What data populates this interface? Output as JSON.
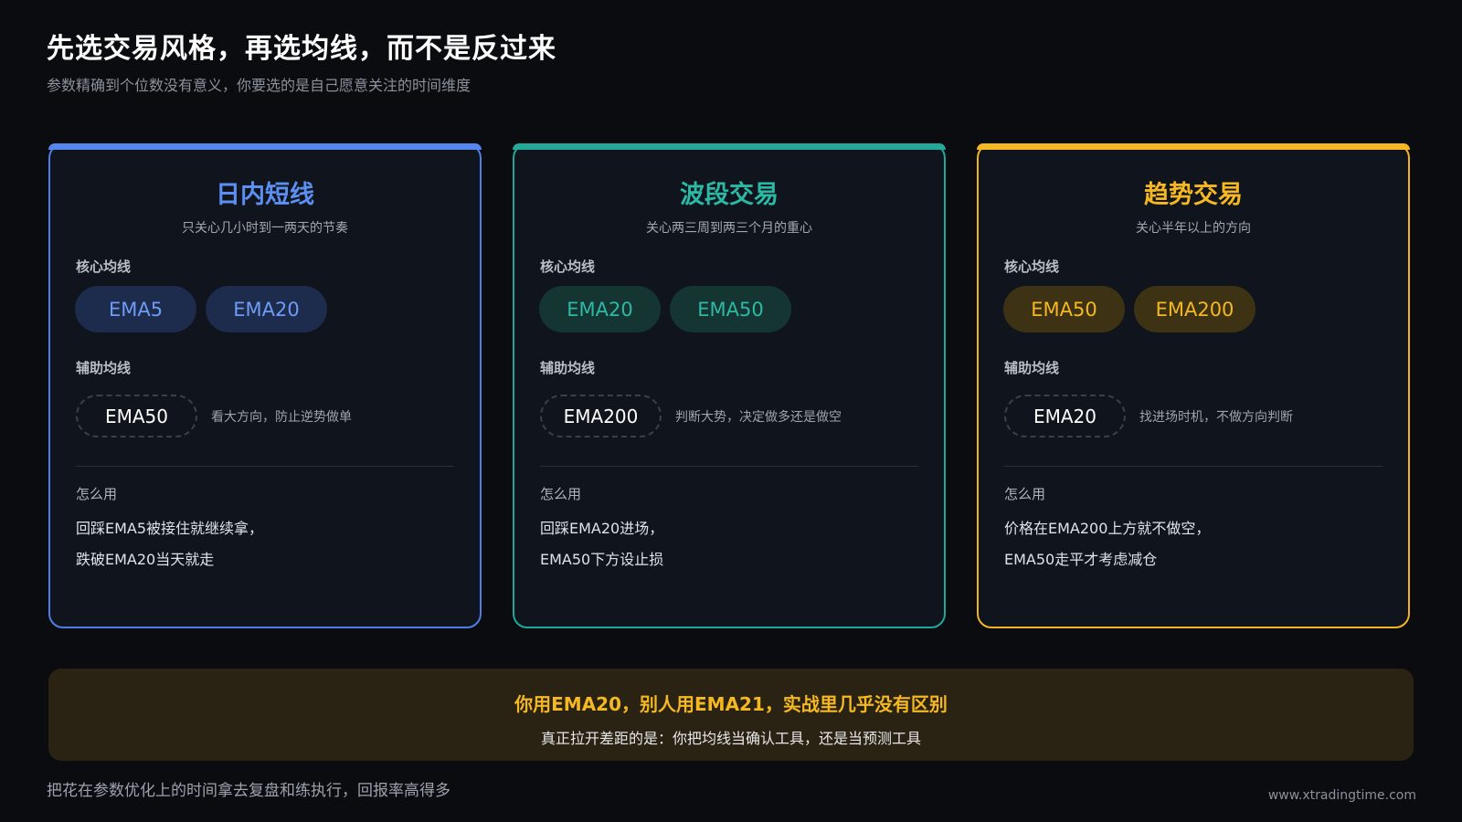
{
  "header": {
    "title": "先选交易风格，再选均线，而不是反过来",
    "subtitle": "参数精确到个位数没有意义，你要选的是自己愿意关注的时间维度"
  },
  "labels": {
    "core": "核心均线",
    "aux": "辅助均线",
    "how": "怎么用"
  },
  "cards": [
    {
      "title": "日内短线",
      "subtitle": "只关心几小时到一两天的节奏",
      "core": [
        "EMA5",
        "EMA20"
      ],
      "aux": "EMA50",
      "aux_note": "看大方向，防止逆势做单",
      "how": [
        "回踩EMA5被接住就继续拿，",
        "跌破EMA20当天就走"
      ],
      "accent": "#5585ee"
    },
    {
      "title": "波段交易",
      "subtitle": "关心两三周到两三个月的重心",
      "core": [
        "EMA20",
        "EMA50"
      ],
      "aux": "EMA200",
      "aux_note": "判断大势，决定做多还是做空",
      "how": [
        "回踩EMA20进场，",
        "EMA50下方设止损"
      ],
      "accent": "#25a898"
    },
    {
      "title": "趋势交易",
      "subtitle": "关心半年以上的方向",
      "core": [
        "EMA50",
        "EMA200"
      ],
      "aux": "EMA20",
      "aux_note": "找进场时机，不做方向判断",
      "how": [
        "价格在EMA200上方就不做空，",
        "EMA50走平才考虑减仓"
      ],
      "accent": "#f5b823"
    }
  ],
  "banner": {
    "title": "你用EMA20，别人用EMA21，实战里几乎没有区别",
    "subtitle": "真正拉开差距的是：你把均线当确认工具，还是当预测工具"
  },
  "footer": {
    "note": "把花在参数优化上的时间拿去复盘和练执行，回报率高得多",
    "url": "www.xtradingtime.com"
  }
}
